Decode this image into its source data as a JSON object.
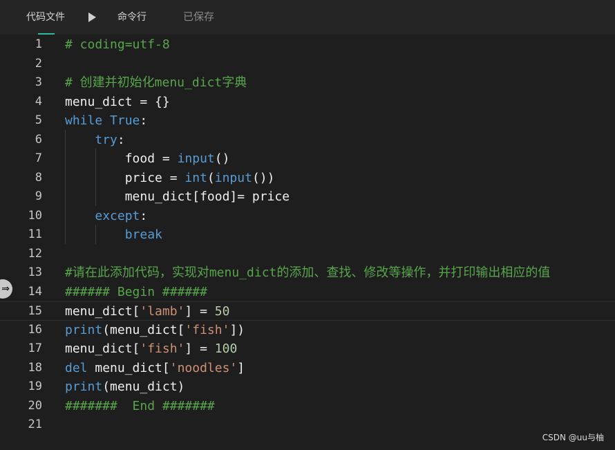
{
  "tabs": [
    {
      "label": "代码文件",
      "active": true
    },
    {
      "label": "命令行",
      "active": false
    }
  ],
  "status": {
    "saved": "已保存"
  },
  "watermark": "CSDN @uu与柚",
  "colors": {
    "keyword": "#569cd6",
    "comment": "#57a64a",
    "string": "#ce9178",
    "number": "#b5cea8",
    "text": "#f0f0f0",
    "accent": "#2fb9a1"
  },
  "editor": {
    "current_line": 15,
    "lines": [
      {
        "n": 1,
        "tokens": [
          [
            "# coding=utf-8",
            "comment"
          ]
        ]
      },
      {
        "n": 2,
        "tokens": []
      },
      {
        "n": 3,
        "tokens": [
          [
            "# 创建并初始化menu_dict字典",
            "comment"
          ]
        ]
      },
      {
        "n": 4,
        "tokens": [
          [
            "menu_dict = {}",
            "text"
          ]
        ]
      },
      {
        "n": 5,
        "tokens": [
          [
            "while",
            "keyword"
          ],
          [
            " ",
            "text"
          ],
          [
            "True",
            "keyword"
          ],
          [
            ":",
            "text"
          ]
        ]
      },
      {
        "n": 6,
        "tokens": [
          [
            "    ",
            "text"
          ],
          [
            "try",
            "keyword"
          ],
          [
            ":",
            "text"
          ]
        ]
      },
      {
        "n": 7,
        "tokens": [
          [
            "        food = ",
            "text"
          ],
          [
            "input",
            "keyword"
          ],
          [
            "()",
            "text"
          ]
        ]
      },
      {
        "n": 8,
        "tokens": [
          [
            "        price = ",
            "text"
          ],
          [
            "int",
            "keyword"
          ],
          [
            "(",
            "text"
          ],
          [
            "input",
            "keyword"
          ],
          [
            "())",
            "text"
          ]
        ]
      },
      {
        "n": 9,
        "tokens": [
          [
            "        menu_dict[food]= price",
            "text"
          ]
        ]
      },
      {
        "n": 10,
        "tokens": [
          [
            "    ",
            "text"
          ],
          [
            "except",
            "keyword"
          ],
          [
            ":",
            "text"
          ]
        ]
      },
      {
        "n": 11,
        "tokens": [
          [
            "        ",
            "text"
          ],
          [
            "break",
            "keyword"
          ]
        ]
      },
      {
        "n": 12,
        "tokens": []
      },
      {
        "n": 13,
        "tokens": [
          [
            "#请在此添加代码，实现对menu_dict的添加、查找、修改等操作，并打印输出相应的值",
            "comment"
          ]
        ]
      },
      {
        "n": 14,
        "tokens": [
          [
            "###### Begin ######",
            "comment"
          ]
        ]
      },
      {
        "n": 15,
        "tokens": [
          [
            "menu_dict[",
            "text"
          ],
          [
            "'lamb'",
            "string"
          ],
          [
            "] = ",
            "text"
          ],
          [
            "50",
            "number"
          ]
        ]
      },
      {
        "n": 16,
        "tokens": [
          [
            "print",
            "keyword"
          ],
          [
            "(menu_dict[",
            "text"
          ],
          [
            "'fish'",
            "string"
          ],
          [
            "])",
            "text"
          ]
        ]
      },
      {
        "n": 17,
        "tokens": [
          [
            "menu_dict[",
            "text"
          ],
          [
            "'fish'",
            "string"
          ],
          [
            "] = ",
            "text"
          ],
          [
            "100",
            "number"
          ]
        ]
      },
      {
        "n": 18,
        "tokens": [
          [
            "del",
            "keyword"
          ],
          [
            " menu_dict[",
            "text"
          ],
          [
            "'noodles'",
            "string"
          ],
          [
            "]",
            "text"
          ]
        ]
      },
      {
        "n": 19,
        "tokens": [
          [
            "print",
            "keyword"
          ],
          [
            "(menu_dict)",
            "text"
          ]
        ]
      },
      {
        "n": 20,
        "tokens": [
          [
            "#######  End #######",
            "comment"
          ]
        ]
      },
      {
        "n": 21,
        "tokens": []
      }
    ]
  }
}
